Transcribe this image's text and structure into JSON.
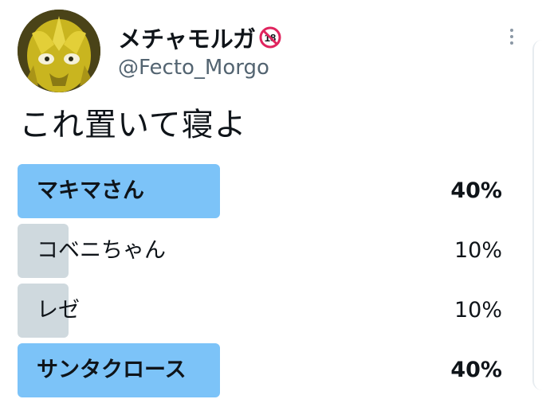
{
  "author": {
    "display_name": "メチャモルガ",
    "handle": "@Fecto_Morgo",
    "badge_icon": "r18-icon",
    "avatar_icon": "avatar-image"
  },
  "tweet": {
    "text": "これ置いて寝よ"
  },
  "poll": {
    "options": [
      {
        "label": "マキマさん",
        "percent": "40%",
        "fraction": 0.4,
        "winner": true
      },
      {
        "label": "コベニちゃん",
        "percent": "10%",
        "fraction": 0.1,
        "winner": false
      },
      {
        "label": "レゼ",
        "percent": "10%",
        "fraction": 0.1,
        "winner": false
      },
      {
        "label": "サンタクロース",
        "percent": "40%",
        "fraction": 0.4,
        "winner": true
      }
    ]
  },
  "colors": {
    "winner_bar": "#7cc3f8",
    "other_bar": "#cfd9de",
    "handle_text": "#536471",
    "r18_ring": "#e0245e"
  }
}
